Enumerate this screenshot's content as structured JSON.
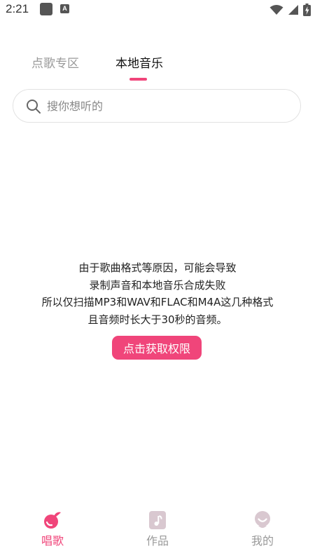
{
  "status_bar": {
    "time": "2:21",
    "notification_badge": "A",
    "icons": [
      "wifi-icon",
      "cell-signal-icon",
      "battery-icon"
    ]
  },
  "tabs": [
    {
      "label": "点歌专区",
      "active": false
    },
    {
      "label": "本地音乐",
      "active": true
    }
  ],
  "search": {
    "placeholder": "搜你想听的",
    "value": ""
  },
  "notice": {
    "lines": [
      "由于歌曲格式等原因，可能会导致",
      "录制声音和本地音乐合成失败",
      "所以仅扫描MP3和WAV和FLAC和M4A这几种格式",
      "且音频时长大于30秒的音频。"
    ]
  },
  "permission_button": {
    "label": "点击获取权限"
  },
  "bottom_nav": {
    "items": [
      {
        "label": "唱歌",
        "icon": "sing-icon",
        "active": true
      },
      {
        "label": "作品",
        "icon": "works-icon",
        "active": false
      },
      {
        "label": "我的",
        "icon": "profile-icon",
        "active": false
      }
    ]
  },
  "colors": {
    "accent": "#f0457a",
    "inactive": "#999999",
    "nav_inactive_icon": "#d9c8d0"
  }
}
